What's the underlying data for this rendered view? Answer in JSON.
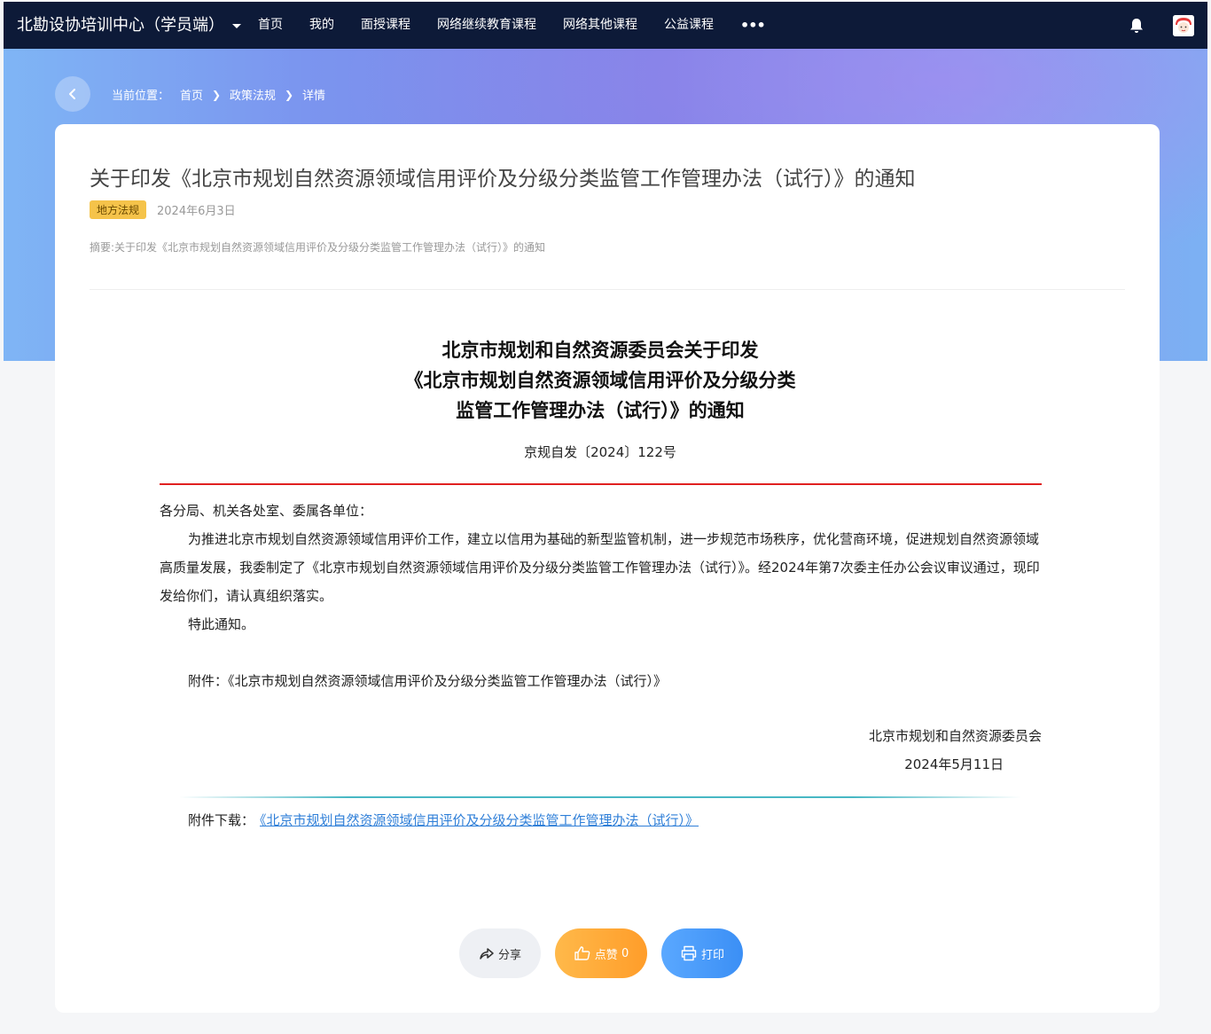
{
  "nav": {
    "brand": "北勘设协培训中心（学员端）",
    "items": [
      "首页",
      "我的",
      "面授课程",
      "网络继续教育课程",
      "网络其他课程",
      "公益课程"
    ],
    "more": "•••"
  },
  "breadcrumb": {
    "label": "当前位置：",
    "items": [
      "首页",
      "政策法规",
      "详情"
    ]
  },
  "article": {
    "title": "关于印发《北京市规划自然资源领域信用评价及分级分类监管工作管理办法（试行）》的通知",
    "category": "地方法规",
    "date": "2024年6月3日",
    "summary": "摘要:关于印发《北京市规划自然资源领域信用评价及分级分类监管工作管理办法（试行）》的通知"
  },
  "document": {
    "title_lines": [
      "北京市规划和自然资源委员会关于印发",
      "《北京市规划自然资源领域信用评价及分级分类",
      "监管工作管理办法（试行）》的通知"
    ],
    "doc_number": "京规自发〔2024〕122号",
    "salutation": "各分局、机关各处室、委属各单位：",
    "paragraph": "为推进北京市规划自然资源领域信用评价工作，建立以信用为基础的新型监管机制，进一步规范市场秩序，优化营商环境，促进规划自然资源领域高质量发展，我委制定了《北京市规划自然资源领域信用评价及分级分类监管工作管理办法（试行）》。经2024年第7次委主任办公会议审议通过，现印发给你们，请认真组织落实。",
    "closing": "特此通知。",
    "attachment": "附件：《北京市规划自然资源领域信用评价及分级分类监管工作管理办法（试行）》",
    "signature_org": "北京市规划和自然资源委员会",
    "signature_date": "2024年5月11日"
  },
  "download": {
    "label": "附件下载：",
    "link": "《北京市规划自然资源领域信用评价及分级分类监管工作管理办法（试行）》"
  },
  "actions": {
    "share": "分享",
    "like": "点赞",
    "like_count": "0",
    "print": "打印"
  },
  "colors": {
    "navbar": "#0d1a38",
    "badge": "#f5c34a",
    "redline": "#e02020",
    "link": "#2f7fd8",
    "like": "#ffa93a",
    "print": "#3b8ff5"
  }
}
